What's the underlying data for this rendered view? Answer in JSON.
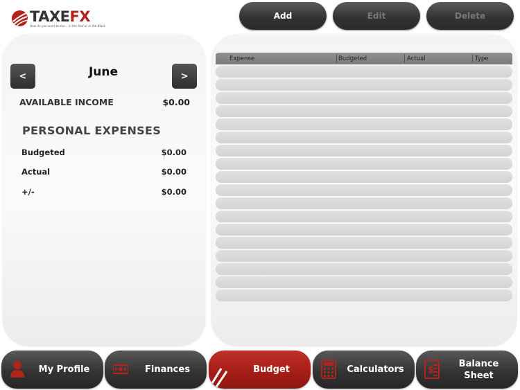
{
  "logo": {
    "word_main": "TAXE",
    "word_accent": "FX",
    "tagline": "How do you want to live... in the Red or in the Black"
  },
  "toolbar": {
    "add": "Add",
    "edit": "Edit",
    "delete": "Delete"
  },
  "left": {
    "prev": "<",
    "next": ">",
    "month": "June",
    "available_income_label": "AVAILABLE INCOME",
    "available_income_value": "$0.00",
    "section_title": "PERSONAL EXPENSES",
    "rows": [
      {
        "label": "Budgeted",
        "value": "$0.00"
      },
      {
        "label": "Actual",
        "value": "$0.00"
      },
      {
        "label": "+/-",
        "value": "$0.00"
      }
    ]
  },
  "table": {
    "columns": [
      "Expense",
      "Budgeted",
      "Actual",
      "Type"
    ],
    "rows": []
  },
  "tabs": {
    "profile": "My Profile",
    "finances": "Finances",
    "budget": "Budget",
    "calculators": "Calculators",
    "balance_sheet": "Balance Sheet",
    "active": "Budget"
  },
  "colors": {
    "accent": "#b3231e",
    "dark": "#333333",
    "panel": "#f4f4f4"
  },
  "icons": [
    "person-icon",
    "money-icon",
    "slash-icon",
    "calculator-icon",
    "balance-sheet-icon"
  ]
}
